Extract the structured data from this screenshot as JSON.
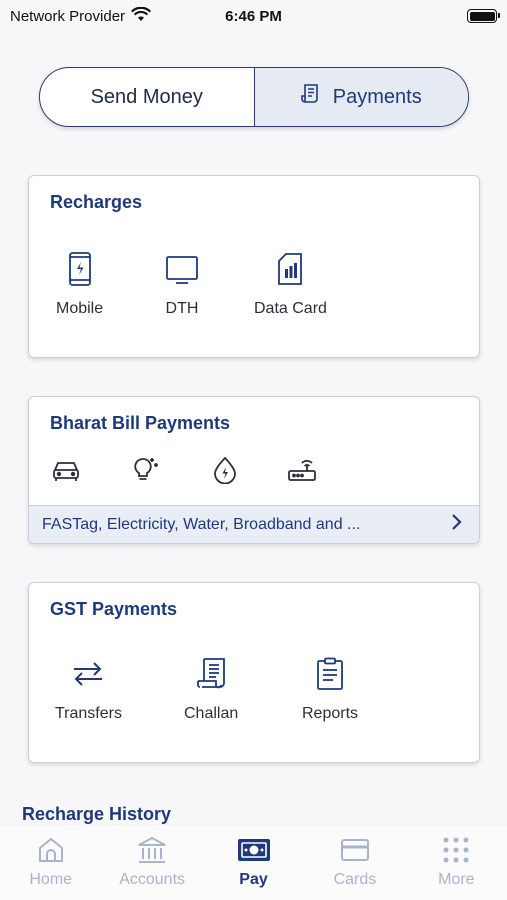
{
  "status_bar": {
    "carrier": "Network Provider",
    "time": "6:46 PM"
  },
  "segment": {
    "send_money": "Send Money",
    "payments": "Payments"
  },
  "recharges": {
    "title": "Recharges",
    "items": [
      {
        "label": "Mobile",
        "icon": "mobile-icon"
      },
      {
        "label": "DTH",
        "icon": "tv-icon"
      },
      {
        "label": "Data Card",
        "icon": "sim-card-icon"
      }
    ]
  },
  "bharat_bill": {
    "title": "Bharat Bill Payments",
    "icons": [
      "car-icon",
      "bulb-icon",
      "water-drop-icon",
      "router-icon"
    ],
    "footer": "FASTag, Electricity, Water, Broadband and ..."
  },
  "gst": {
    "title": "GST Payments",
    "items": [
      {
        "label": "Transfers",
        "icon": "transfer-icon"
      },
      {
        "label": "Challan",
        "icon": "challan-icon"
      },
      {
        "label": "Reports",
        "icon": "reports-icon"
      }
    ]
  },
  "recharge_history": {
    "title": "Recharge History"
  },
  "bottom_nav": {
    "items": [
      {
        "label": "Home",
        "icon": "home-icon"
      },
      {
        "label": "Accounts",
        "icon": "bank-icon"
      },
      {
        "label": "Pay",
        "icon": "pay-icon",
        "active": true
      },
      {
        "label": "Cards",
        "icon": "card-icon"
      },
      {
        "label": "More",
        "icon": "grid-icon"
      }
    ]
  },
  "colors": {
    "accent": "#1f3a7a",
    "inactive": "#a9b4cc",
    "card_footer": "#e9edf5"
  }
}
